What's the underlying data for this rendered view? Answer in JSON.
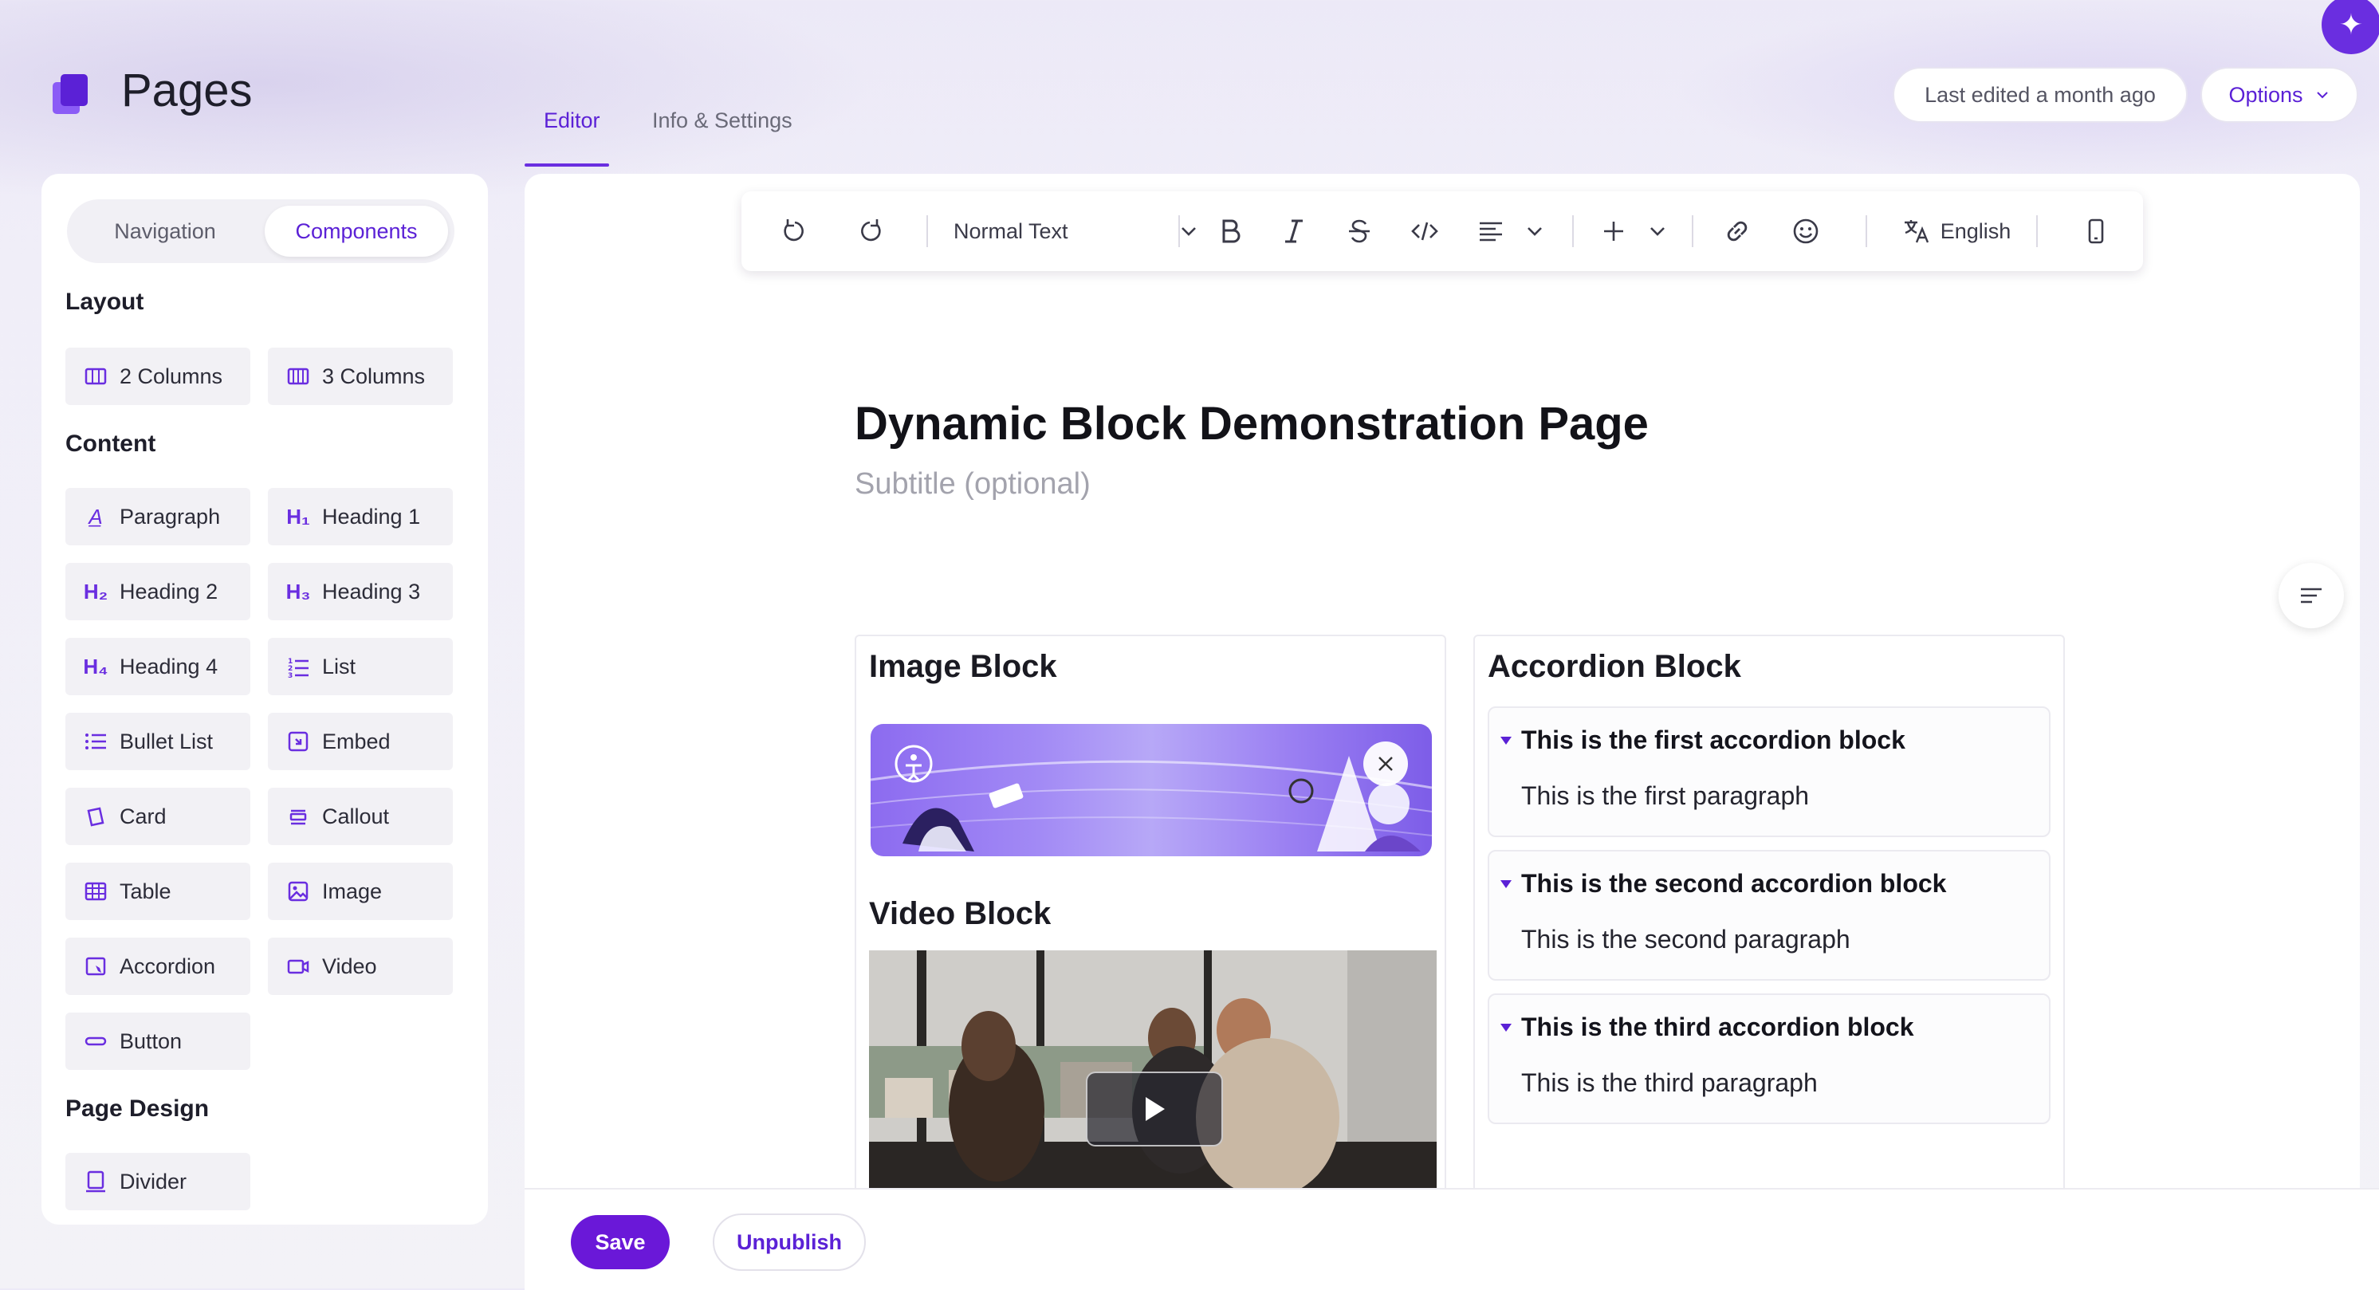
{
  "app": {
    "title": "Pages"
  },
  "tabs": [
    {
      "label": "Editor",
      "active": true
    },
    {
      "label": "Info & Settings",
      "active": false
    }
  ],
  "header": {
    "last_edited": "Last edited a month ago",
    "options_label": "Options"
  },
  "sidebar": {
    "segments": [
      {
        "label": "Navigation",
        "active": false
      },
      {
        "label": "Components",
        "active": true
      }
    ],
    "sections": {
      "layout": "Layout",
      "content": "Content",
      "page_design": "Page Design"
    },
    "layout_items": [
      "2 Columns",
      "3 Columns"
    ],
    "content_items": [
      "Paragraph",
      "Heading 1",
      "Heading 2",
      "Heading 3",
      "Heading 4",
      "List",
      "Bullet List",
      "Embed",
      "Card",
      "Callout",
      "Table",
      "Image",
      "Accordion",
      "Video",
      "Button"
    ],
    "design_items": [
      "Divider"
    ]
  },
  "toolbar": {
    "text_style": "Normal Text",
    "language": "English"
  },
  "page": {
    "title": "Dynamic Block Demonstration Page",
    "subtitle_placeholder": "Subtitle (optional)"
  },
  "blocks": {
    "image_title": "Image Block",
    "video_title": "Video Block",
    "accordion_title": "Accordion Block",
    "accordion_items": [
      {
        "heading": "This is the first accordion block",
        "body": "This is the first paragraph"
      },
      {
        "heading": "This is the second accordion block",
        "body": "This is the second paragraph"
      },
      {
        "heading": "This is the third accordion block",
        "body": "This is the third paragraph"
      }
    ]
  },
  "footer": {
    "save": "Save",
    "unpublish": "Unpublish"
  },
  "colors": {
    "accent": "#6a18d8",
    "accent_text": "#5b21d6"
  }
}
